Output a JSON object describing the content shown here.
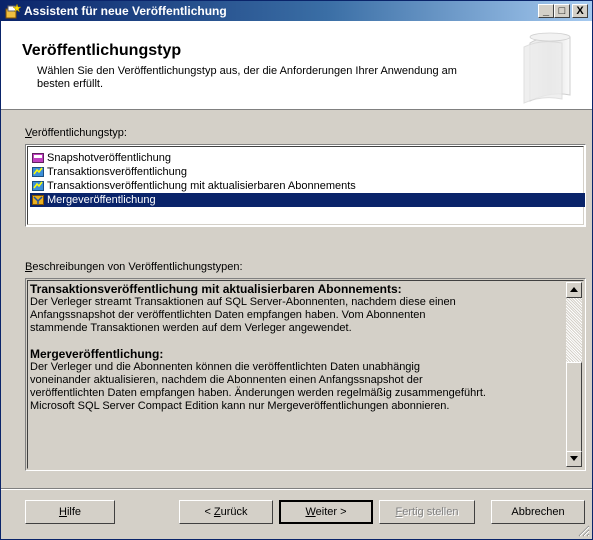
{
  "window": {
    "title": "Assistent für neue Veröffentlichung",
    "app_icon": "wizard-icon",
    "controls": {
      "minimize": "_",
      "maximize": "□",
      "close": "X"
    }
  },
  "header": {
    "title": "Veröffentlichungstyp",
    "description": "Wählen Sie den Veröffentlichungstyp aus, der die Anforderungen Ihrer Anwendung am besten erfüllt."
  },
  "type_list": {
    "label_prefix": "",
    "label_mnemonic": "V",
    "label_rest": "eröffentlichungstyp:",
    "items": [
      {
        "label": "Snapshotveröffentlichung",
        "icon": "snapshot-publication-icon",
        "selected": false
      },
      {
        "label": "Transaktionsveröffentlichung",
        "icon": "transactional-publication-icon",
        "selected": false
      },
      {
        "label": "Transaktionsveröffentlichung mit aktualisierbaren Abonnements",
        "icon": "transactional-updatable-publication-icon",
        "selected": false
      },
      {
        "label": "Mergeveröffentlichung",
        "icon": "merge-publication-icon",
        "selected": true
      }
    ]
  },
  "descriptions": {
    "label_mnemonic": "B",
    "label_rest": "eschreibungen von Veröffentlichungstypen:",
    "blocks": [
      {
        "heading": "Transaktionsveröffentlichung mit aktualisierbaren Abonnements:",
        "lines": [
          "Der Verleger streamt Transaktionen auf SQL Server-Abonnenten, nachdem diese einen",
          "Anfangssnapshot der veröffentlichten Daten empfangen haben. Vom Abonnenten",
          "stammende Transaktionen werden auf dem Verleger angewendet."
        ]
      },
      {
        "heading": "Mergeveröffentlichung:",
        "lines": [
          "Der Verleger und die Abonnenten können die veröffentlichten Daten unabhängig",
          "voneinander aktualisieren, nachdem die Abonnenten einen Anfangssnapshot der",
          "veröffentlichten Daten empfangen haben. Änderungen werden regelmäßig zusammengeführt.",
          "Microsoft SQL Server Compact Edition kann nur Mergeveröffentlichungen abonnieren."
        ]
      }
    ]
  },
  "buttons": {
    "help": {
      "mnemonic": "H",
      "rest": "ilfe"
    },
    "back": {
      "prefix": "< ",
      "mnemonic": "Z",
      "rest": "urück"
    },
    "next": {
      "mnemonic": "W",
      "rest": "eiter >"
    },
    "finish": {
      "mnemonic": "F",
      "rest": "ertig stellen"
    },
    "cancel": {
      "label": "Abbrechen"
    }
  },
  "colors": {
    "selection": "#0a246a",
    "title_gradient_start": "#0a246a",
    "title_gradient_end": "#a6caf0",
    "face": "#d4d0c8"
  }
}
